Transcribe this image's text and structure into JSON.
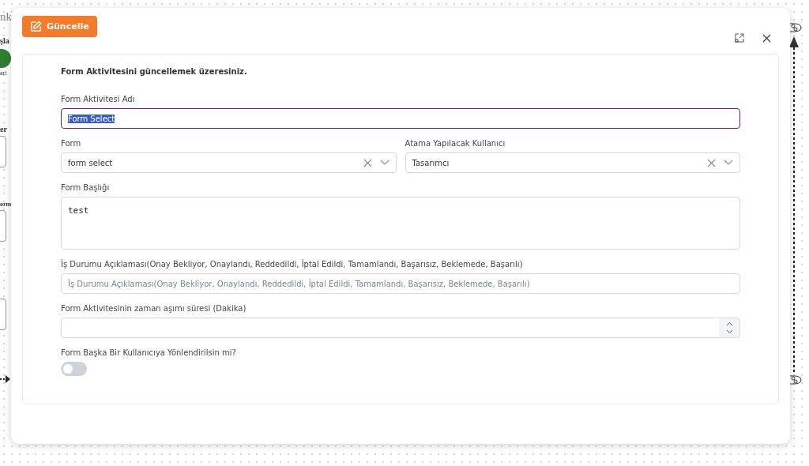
{
  "canvas": {
    "fragments": [
      {
        "text": "nk",
        "kind": "title"
      },
      {
        "text": "şla",
        "kind": "label"
      },
      {
        "text": "art",
        "kind": "small"
      },
      {
        "text": "er",
        "kind": "label"
      },
      {
        "text": "orm",
        "kind": "label"
      }
    ]
  },
  "modal": {
    "action_button": "Güncelle",
    "intro": "Form Aktivitesini güncellemek üzeresiniz.",
    "fields": [
      {
        "kind": "text",
        "label": "Form Aktivitesi Adı",
        "value": "Form Select",
        "selected": true
      },
      {
        "kind": "pair",
        "items": [
          {
            "label": "Form",
            "value": "form select"
          },
          {
            "label": "Atama Yapılacak Kullanıcı",
            "value": "Tasarımcı"
          }
        ]
      },
      {
        "kind": "textarea",
        "label": "Form Başlığı",
        "value": "test"
      },
      {
        "kind": "text",
        "label": "İş Durumu Açıklaması(Onay Bekliyor, Onaylandı, Reddedildi, İptal Edildi, Tamamlandı, Başarısız, Beklemede, Başarılı)",
        "placeholder": "İş Durumu Açıklaması(Onay Bekliyor, Onaylandı, Reddedildi, İptal Edildi, Tamamlandı, Başarısız, Beklemede, Başarılı)",
        "selected": false
      },
      {
        "kind": "number",
        "label": "Form Aktivitesinin zaman aşımı süresi (Dakika)"
      },
      {
        "kind": "switch",
        "label": "Form Başka Bir Kullanıcıya Yönlendirilsin mi?",
        "on": false
      }
    ]
  }
}
